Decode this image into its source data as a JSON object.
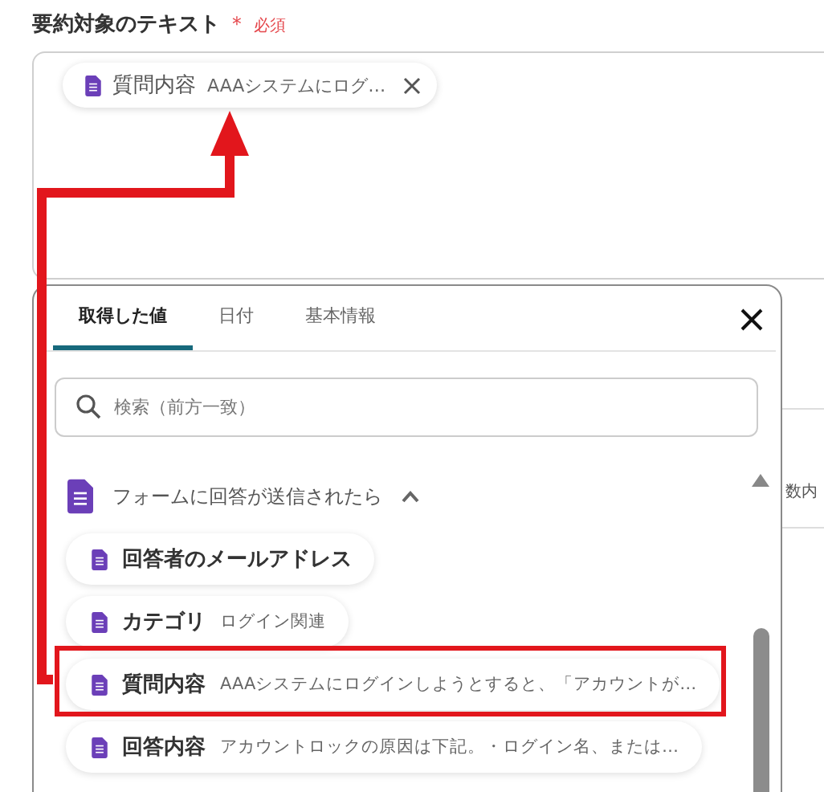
{
  "field": {
    "label": "要約対象のテキスト",
    "required_mark": "＊",
    "required_text": "必須",
    "chips": [
      {
        "name": "質問内容",
        "value": "AAAシステムにログ…"
      }
    ]
  },
  "picker": {
    "tabs": [
      {
        "label": "取得した値",
        "selected": true
      },
      {
        "label": "日付",
        "selected": false
      },
      {
        "label": "基本情報",
        "selected": false
      }
    ],
    "search": {
      "placeholder": "検索（前方一致）"
    },
    "group": {
      "title": "フォームに回答が送信されたら",
      "expanded": true,
      "items": [
        {
          "name": "回答者のメールアドレス",
          "highlighted": false
        },
        {
          "name": "カテゴリ",
          "value": "ログイン関連",
          "highlighted": false
        },
        {
          "name": "質問内容",
          "value": "AAAシステムにログインしようとすると、「アカウントが…",
          "highlighted": true
        },
        {
          "name": "回答内容",
          "value": "アカウントロックの原因は下記。・ログイン名、または…",
          "highlighted": false
        }
      ]
    }
  },
  "background_text": "数内"
}
